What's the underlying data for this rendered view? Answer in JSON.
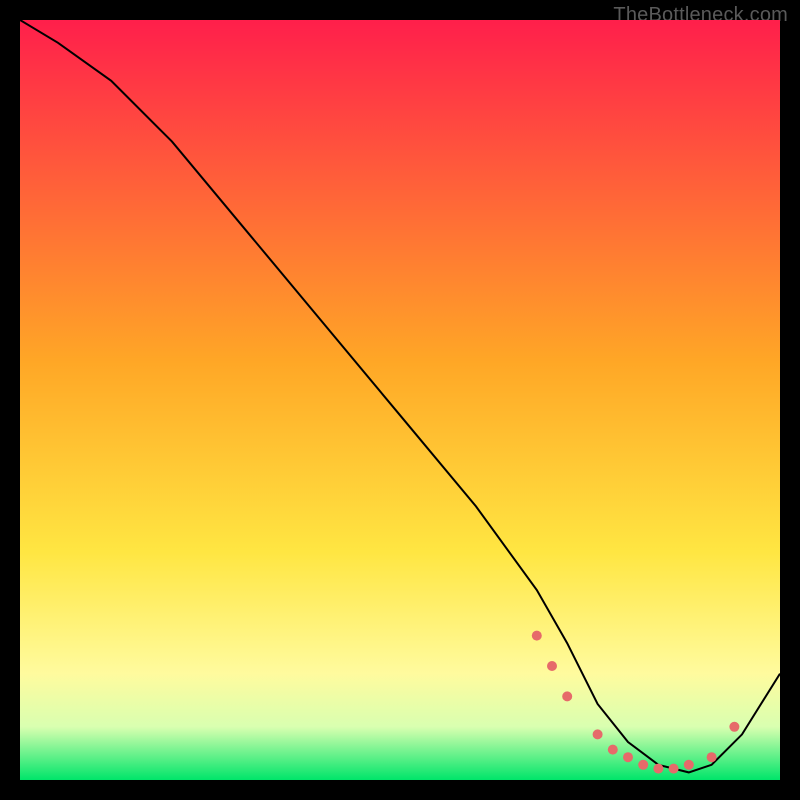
{
  "watermark": "TheBottleneck.com",
  "chart_data": {
    "type": "line",
    "title": "",
    "xlabel": "",
    "ylabel": "",
    "xlim": [
      0,
      100
    ],
    "ylim": [
      0,
      100
    ],
    "grid": false,
    "gradient_stops": [
      {
        "offset": 0.0,
        "color": "#ff1f4b"
      },
      {
        "offset": 0.45,
        "color": "#ffa726"
      },
      {
        "offset": 0.7,
        "color": "#ffe642"
      },
      {
        "offset": 0.86,
        "color": "#fffb9e"
      },
      {
        "offset": 0.93,
        "color": "#d9ffb0"
      },
      {
        "offset": 1.0,
        "color": "#00e56a"
      }
    ],
    "series": [
      {
        "name": "bottleneck-curve",
        "color": "#000000",
        "x": [
          0,
          5,
          12,
          20,
          30,
          40,
          50,
          60,
          68,
          72,
          76,
          80,
          84,
          88,
          91,
          95,
          100
        ],
        "y": [
          100,
          97,
          92,
          84,
          72,
          60,
          48,
          36,
          25,
          18,
          10,
          5,
          2,
          1,
          2,
          6,
          14
        ]
      }
    ],
    "markers": {
      "name": "highlight-points",
      "color": "#e66a6a",
      "radius": 5,
      "x": [
        68,
        70,
        72,
        76,
        78,
        80,
        82,
        84,
        86,
        88,
        91,
        94
      ],
      "y": [
        19,
        15,
        11,
        6,
        4,
        3,
        2,
        1.5,
        1.5,
        2,
        3,
        7
      ]
    }
  }
}
